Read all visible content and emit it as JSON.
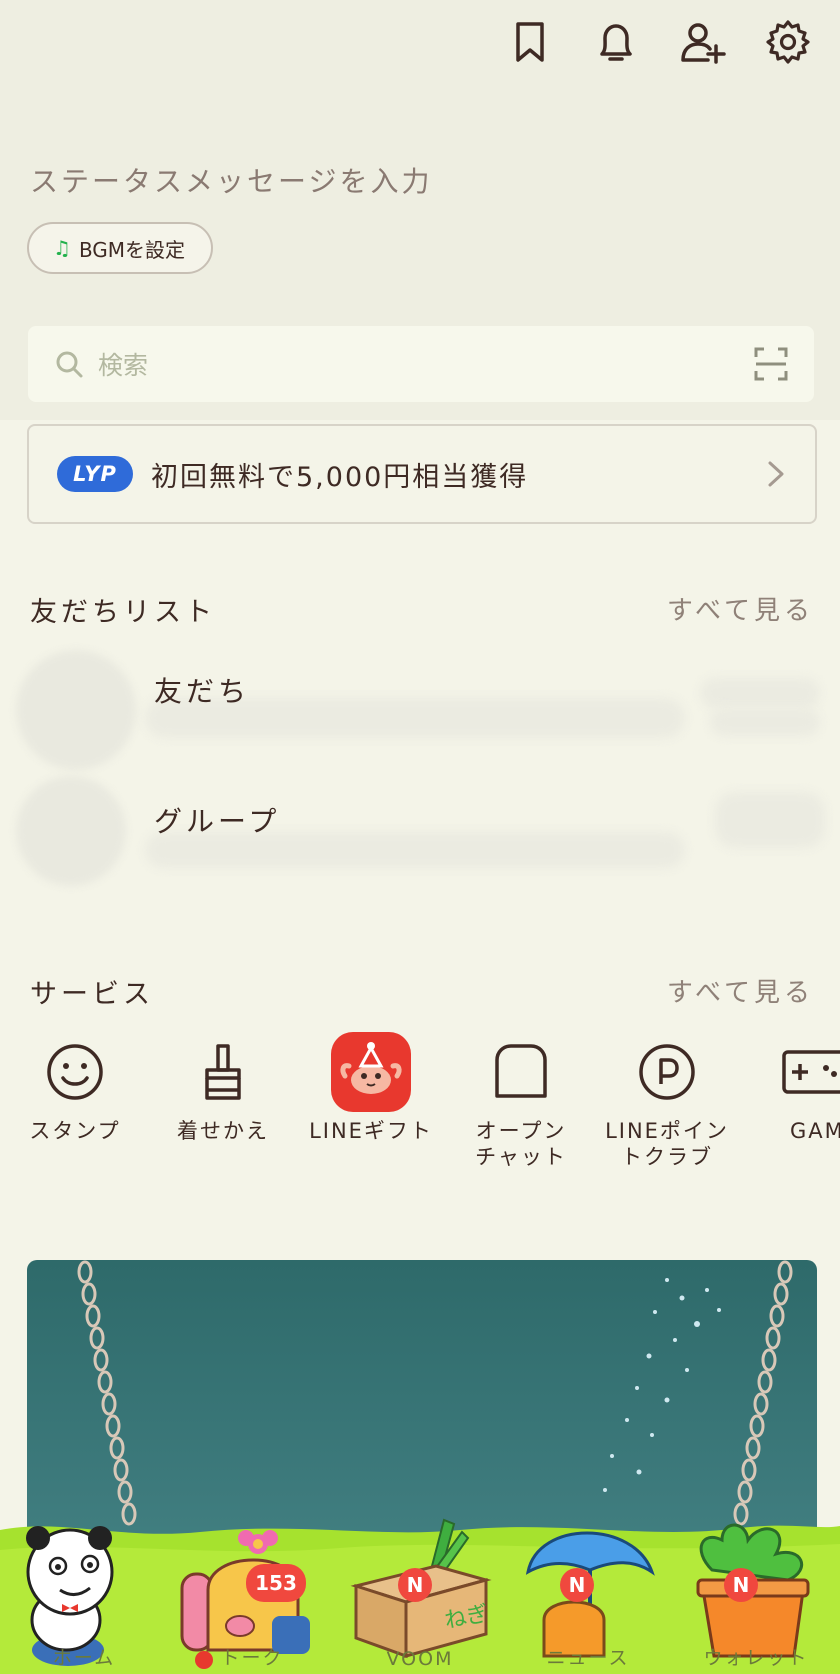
{
  "header": {
    "icons": [
      "bookmark-icon",
      "bell-icon",
      "add-friend-icon",
      "gear-icon"
    ]
  },
  "profile": {
    "status_placeholder": "ステータスメッセージを入力",
    "bgm_label": "BGMを設定"
  },
  "search": {
    "placeholder": "検索"
  },
  "promo": {
    "logo": "LYP",
    "text": "初回無料で5,000円相当獲得"
  },
  "friends_section": {
    "title": "友だちリスト",
    "see_all": "すべて見る",
    "rows": [
      {
        "label": "友だち"
      },
      {
        "label": "グループ"
      }
    ]
  },
  "services_section": {
    "title": "サービス",
    "see_all": "すべて見る",
    "items": [
      {
        "label": "スタンプ",
        "icon": "smiley-icon"
      },
      {
        "label": "着せかえ",
        "icon": "brush-icon"
      },
      {
        "label": "LINEギフト",
        "icon": "gift-crab-icon"
      },
      {
        "label": "オープン\nチャット",
        "icon": "open-chat-icon"
      },
      {
        "label": "LINEポイン\nトクラブ",
        "icon": "points-icon"
      },
      {
        "label": "GAME",
        "icon": "game-controller-icon"
      }
    ]
  },
  "tabbar": {
    "tabs": [
      {
        "label": "ホーム",
        "badge": ""
      },
      {
        "label": "トーク",
        "badge": "153"
      },
      {
        "label": "VOOM",
        "badge": "N"
      },
      {
        "label": "ニュース",
        "badge": "N"
      },
      {
        "label": "ウォレット",
        "badge": "N"
      }
    ],
    "box_text": "ねぎ"
  },
  "colors": {
    "background": "#f4f4e8",
    "text": "#3e2a24",
    "accent_green": "#22b14c",
    "badge_red": "#f0483e",
    "lyp_blue": "#2f6bd9",
    "grass": "#a6e22e"
  }
}
